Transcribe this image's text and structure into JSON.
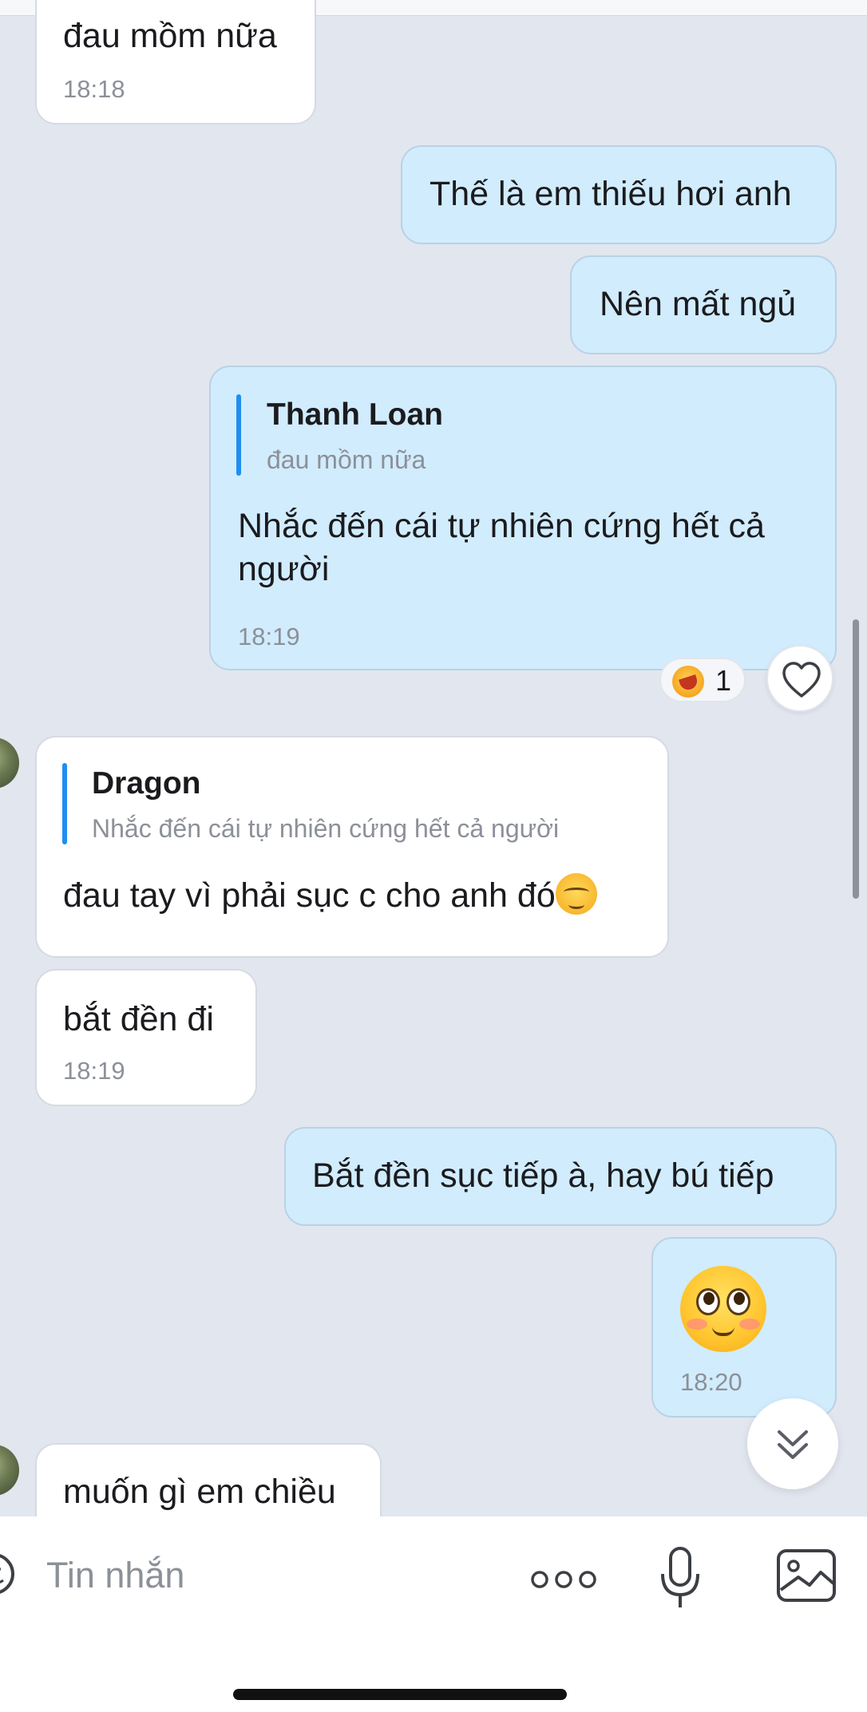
{
  "messages": {
    "m1": {
      "sender": "in",
      "text": "đau mồm nữa",
      "time": "18:18"
    },
    "m2": {
      "sender": "out",
      "text": "Thế là em thiếu hơi anh"
    },
    "m3": {
      "sender": "out",
      "text": "Nên mất ngủ"
    },
    "m4": {
      "sender": "out",
      "quote_name": "Thanh Loan",
      "quote_text": "đau mồm nữa",
      "text_line1": "Nhắc đến cái tự nhiên cứng hết cả",
      "text_line2": "người",
      "time": "18:19",
      "reaction_count": "1"
    },
    "m5": {
      "sender": "in",
      "quote_name": "Dragon",
      "quote_text": "Nhắc đến cái tự nhiên cứng hết cả người",
      "text": "đau tay vì phải sục c cho anh đó"
    },
    "m6": {
      "sender": "in",
      "text": "bắt đền đi",
      "time": "18:19"
    },
    "m7": {
      "sender": "out",
      "text": "Bắt đền sục tiếp à, hay bú tiếp"
    },
    "m8": {
      "sender": "out",
      "emoji": "rolling-eyes-blush-emoji",
      "time": "18:20"
    },
    "m9": {
      "sender": "in",
      "text": "muốn gì em chiều"
    }
  },
  "input": {
    "placeholder": "Tin nhắn"
  },
  "colors": {
    "background": "#e2e6ef",
    "incoming_bubble": "#ffffff",
    "outgoing_bubble": "#d1ecfd",
    "quote_accent": "#1f8ef1"
  },
  "icons": [
    "sticker-icon",
    "more-icon",
    "microphone-icon",
    "image-icon",
    "heart-icon",
    "chevron-down-double-icon"
  ]
}
